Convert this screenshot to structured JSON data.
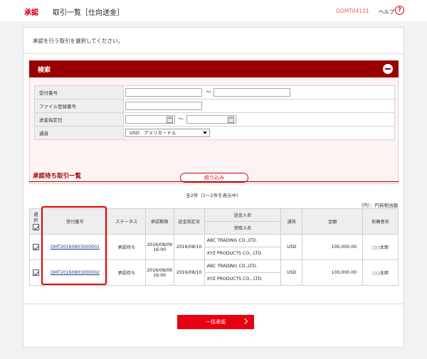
{
  "header": {
    "category": "承認",
    "title": "取引一覧［仕向送金］",
    "screen_code": "GOMT04101",
    "help_label": "ヘルプ",
    "help_symbol": "?"
  },
  "instruction": "承認を行う取引を選択してください。",
  "search": {
    "title": "検索",
    "fields": [
      {
        "label": "受付番号"
      },
      {
        "label": "ファイル登録番号"
      },
      {
        "label": "送金指定日"
      },
      {
        "label": "通貨"
      }
    ],
    "range_separator": "～",
    "currency_value": "USD　アメリカ・ドル",
    "narrow_button": "絞り込み"
  },
  "list": {
    "title": "承認待ち取引一覧",
    "count_text": "全2件（1～2件を表示中）",
    "unit_text": "（円）：円貨相当額",
    "headers": {
      "select": "選択",
      "receipt_no": "受付番号",
      "status": "ステータス",
      "approval_deadline": "承認期限",
      "remit_date": "送金指定日",
      "remitter_name": "送金人名",
      "payee_name": "受取人名",
      "currency": "通貨",
      "amount": "金額",
      "requester": "依頼者名"
    },
    "rows": [
      {
        "receipt_no": "OMT20160803000001",
        "status": "承認待ち",
        "deadline": "2016/08/09",
        "deadline_time": "16:00",
        "remit_date": "2016/08/10",
        "remitter": "ABC TRADING CO.,LTD.",
        "payee": "XYZ PRODUCTS CO., LTD.",
        "currency": "USD",
        "amount": "100,000.00",
        "requester": "○○太郎",
        "checked": true
      },
      {
        "receipt_no": "OMT20160803000002",
        "status": "承認待ち",
        "deadline": "2016/08/09",
        "deadline_time": "16:00",
        "remit_date": "2016/08/10",
        "remitter": "ABC TRADING CO.,LTD.",
        "payee": "XYZ PRODUCTS CO., LTD.",
        "currency": "USD",
        "amount": "100,000.00",
        "requester": "○○太郎",
        "checked": true
      }
    ]
  },
  "footer": {
    "approve_button": "一括承認"
  },
  "colors": {
    "brand_red": "#d7000f",
    "panel_header": "#9b0000",
    "button_red": "#e60012",
    "link_blue": "#1a3c8f"
  }
}
